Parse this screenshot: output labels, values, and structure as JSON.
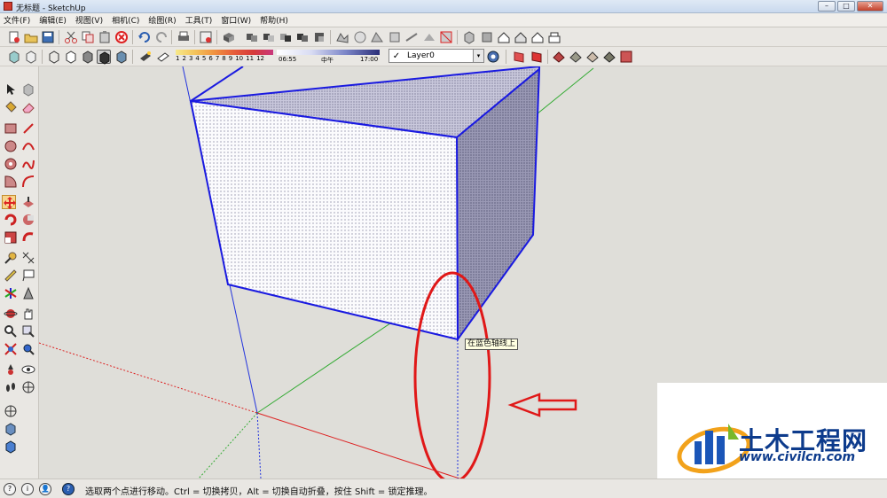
{
  "window": {
    "title": "无标题 - SketchUp",
    "controls": {
      "minimize": "–",
      "maximize": "□",
      "close": "✕"
    }
  },
  "menu": [
    {
      "label": "文件(F)"
    },
    {
      "label": "编辑(E)"
    },
    {
      "label": "视图(V)"
    },
    {
      "label": "相机(C)"
    },
    {
      "label": "绘图(R)"
    },
    {
      "label": "工具(T)"
    },
    {
      "label": "窗口(W)"
    },
    {
      "label": "帮助(H)"
    }
  ],
  "shadow_scale": {
    "months": [
      "1",
      "2",
      "3",
      "4",
      "5",
      "6",
      "7",
      "8",
      "9",
      "10",
      "11",
      "12"
    ],
    "time_start": "06:55",
    "time_mid": "中午",
    "time_end": "17:00"
  },
  "layer": {
    "check": "✓",
    "name": "Layer0",
    "dropdown": "▾"
  },
  "viewport": {
    "tooltip": "在蓝色轴线上",
    "colors": {
      "edge": "#1a1ae0",
      "red_axis": "#d22",
      "green_axis": "#3a3",
      "blue_axis": "#2233dd",
      "annotation": "#e01818"
    }
  },
  "watermark": {
    "name": "土木工程网",
    "url": "www.civilcn.com"
  },
  "status": {
    "icons": [
      "?",
      "i",
      "👤",
      "?"
    ],
    "text": "选取两个点进行移动。Ctrl = 切换拷贝，Alt = 切换自动折叠，按住 Shift = 锁定推理。"
  }
}
